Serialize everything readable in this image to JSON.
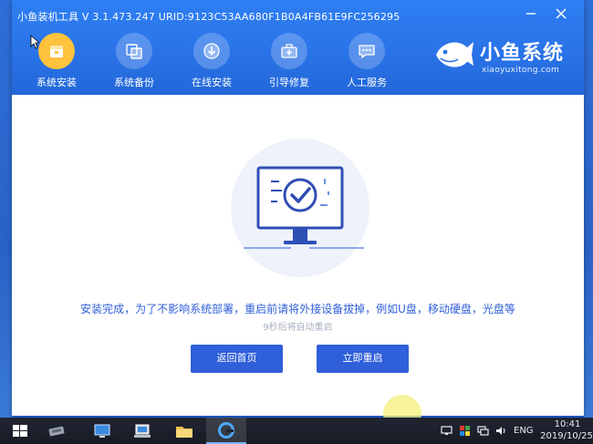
{
  "app": {
    "title": "小鱼装机工具 V 3.1.473.247 URID:9123C53AA680F1B0A4FB61E9FC256295",
    "nav": [
      {
        "label": "系统安装",
        "icon": "install-icon",
        "active": true
      },
      {
        "label": "系统备份",
        "icon": "backup-icon",
        "active": false
      },
      {
        "label": "在线安装",
        "icon": "download-icon",
        "active": false
      },
      {
        "label": "引导修复",
        "icon": "repair-kit-icon",
        "active": false
      },
      {
        "label": "人工服务",
        "icon": "chat-icon",
        "active": false
      }
    ],
    "brand": {
      "name": "小鱼系统",
      "url": "xiaoyuxitong.com"
    },
    "message": "安装完成，为了不影响系统部署，重启前请将外接设备拔掉，例如U盘，移动硬盘，光盘等",
    "countdown": "9秒后将自动重启",
    "buttons": {
      "home": "返回首页",
      "reboot": "立即重启"
    }
  },
  "taskbar": {
    "language": "ENG",
    "time": "10:41",
    "date": "2019/10/25"
  },
  "colors": {
    "header_blue": "#2a73e8",
    "accent": "#2f5fd9",
    "active_nav": "#ffc23d",
    "countdown_gray": "#a8b0c0"
  }
}
